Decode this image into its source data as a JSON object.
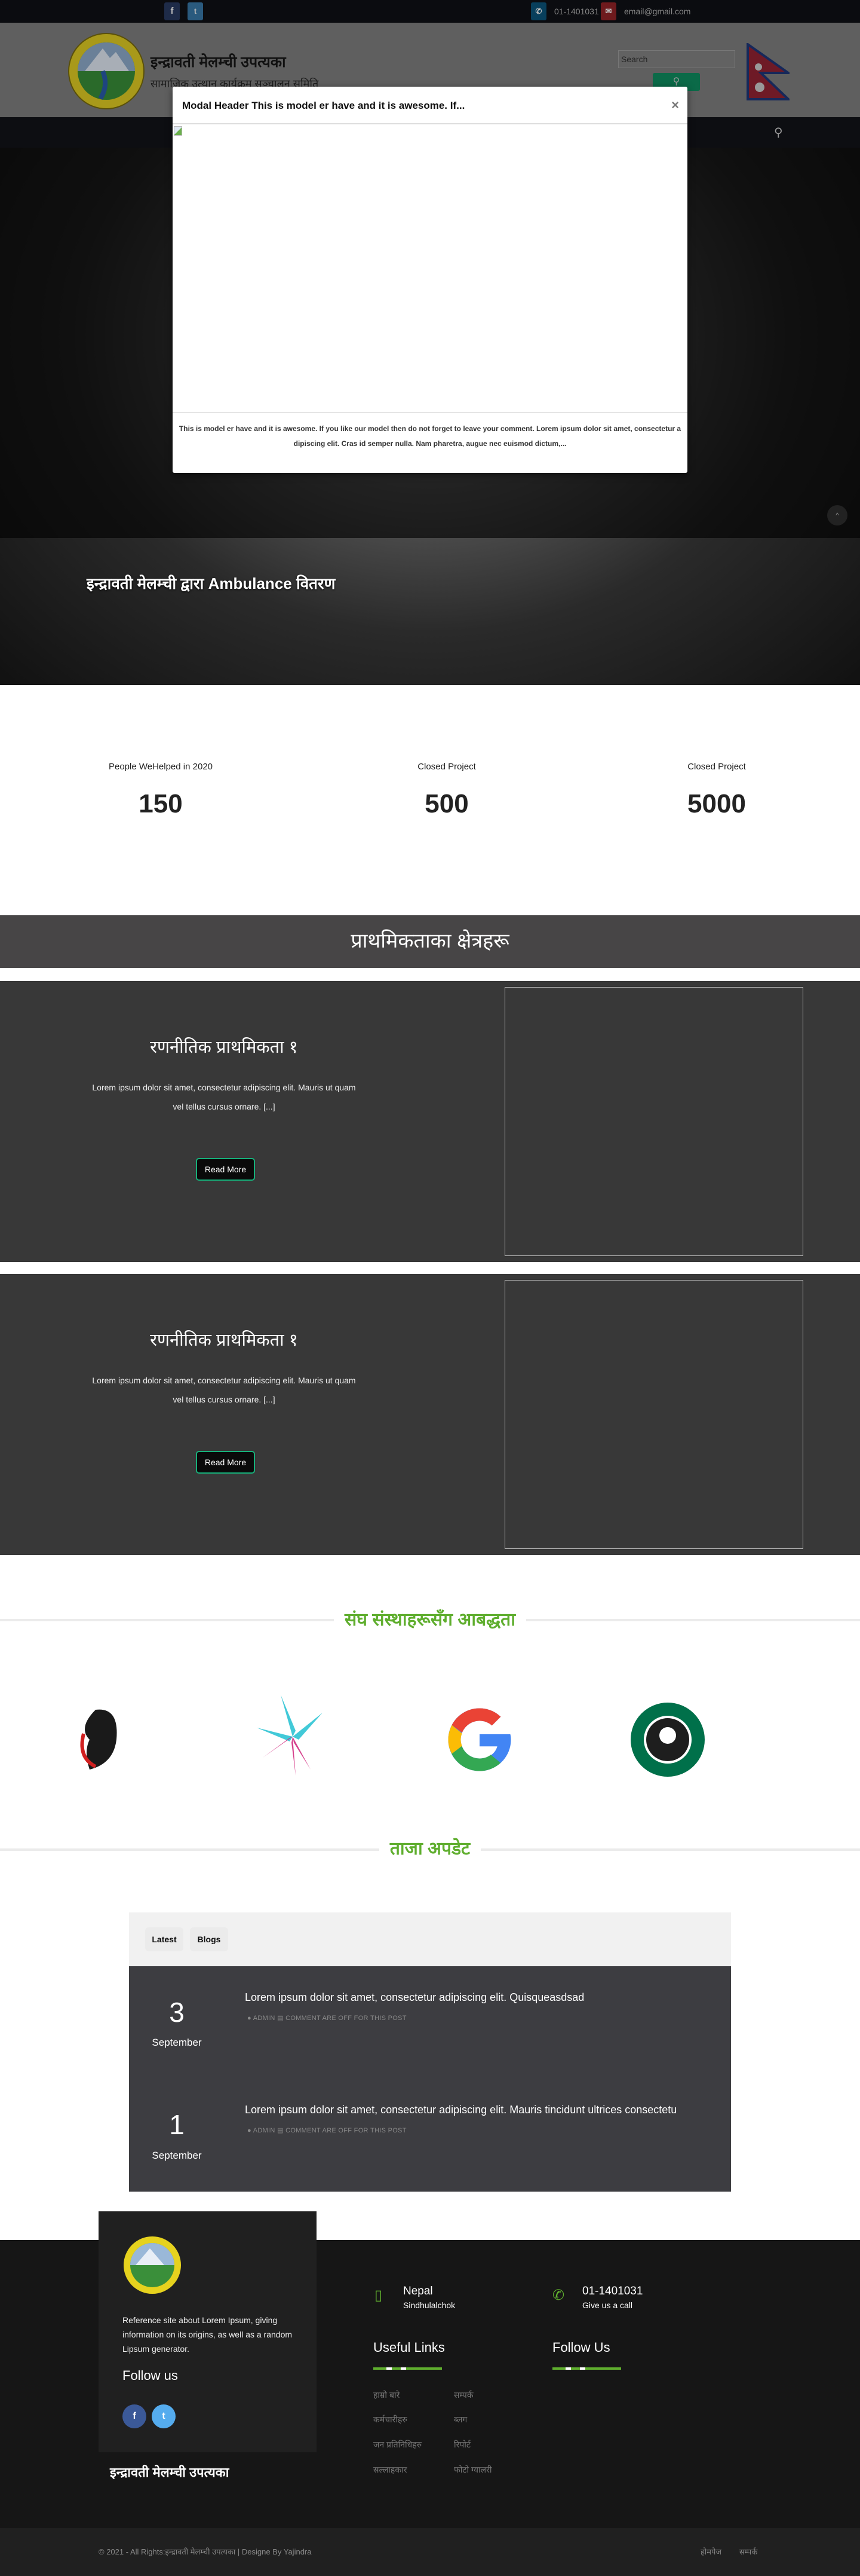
{
  "topbar": {
    "phone": "01-1401031",
    "email": "email@gmail.com",
    "social": [
      "facebook-icon",
      "twitter-icon"
    ]
  },
  "header": {
    "title": "इन्द्रावती मेलम्ची उपत्यका",
    "subtitle": "सामाजिक उत्थान कार्यक्रम सञ्चालन समिति",
    "search_placeholder": "Search"
  },
  "modal": {
    "title": "Modal Header This is model er have and it is awesome. If...",
    "close": "×",
    "body": "This is model er have and it is awesome. If you like our model then do not forget to leave your comment. Lorem ipsum dolor sit amet, consectetur a dipiscing elit. Cras id semper nulla. Nam pharetra, augue nec euismod dictum,..."
  },
  "hero": {
    "caption": "इन्द्रावती मेलम्ची द्वारा Ambulance वितरण",
    "scroll_top": "^"
  },
  "stats": [
    {
      "label": "People WeHelped in 2020",
      "value": "150"
    },
    {
      "label": "Closed Project",
      "value": "500"
    },
    {
      "label": "Closed Project",
      "value": "5000"
    }
  ],
  "priorities": {
    "heading": "प्राथमिकताका क्षेत्रहरू",
    "items": [
      {
        "title": "रणनीतिक प्राथमिकता १",
        "text": "Lorem ipsum dolor sit amet, consectetur adipiscing elit. Mauris ut quam vel tellus cursus ornare. [...]",
        "button": "Read More"
      },
      {
        "title": "रणनीतिक प्राथमिकता १",
        "text": "Lorem ipsum dolor sit amet, consectetur adipiscing elit. Mauris ut quam vel tellus cursus ornare. [...]",
        "button": "Read More"
      }
    ]
  },
  "partners": {
    "heading": "संघ संस्थाहरूसँग आबद्धता"
  },
  "updates": {
    "heading": "ताजा अपडेट",
    "tabs": [
      "Latest",
      "Blogs"
    ],
    "posts": [
      {
        "day": "3",
        "month": "September",
        "title": "Lorem ipsum dolor sit amet, consectetur adipiscing elit. Quisqueasdsad",
        "author": "ADMIN",
        "comments": "COMMENT ARE OFF FOR THIS POST"
      },
      {
        "day": "1",
        "month": "September",
        "title": "Lorem ipsum dolor sit amet, consectetur adipiscing elit. Mauris tincidunt ultrices consectetu",
        "author": "ADMIN",
        "comments": "COMMENT ARE OFF FOR THIS POST"
      }
    ]
  },
  "footer": {
    "about": "Reference site about Lorem Ipsum, giving information on its origins, as well as a random Lipsum generator.",
    "follow_us": "Follow us",
    "org_name": "इन्द्रावती मेलम्ची उपत्यका",
    "location": {
      "title": "Nepal",
      "sub": "Sindhulalchok"
    },
    "phone": {
      "title": "01-1401031",
      "sub": "Give us a call"
    },
    "useful_links_title": "Useful Links",
    "follow_title": "Follow Us",
    "links": [
      "हाम्रो बारे",
      "सम्पर्क",
      "कर्मचारीहरु",
      "ब्लग",
      "जन प्रतिनिधिहरु",
      "रिपोर्ट",
      "सल्लाहकार",
      "फोटो ग्यालरी"
    ],
    "copyright": "© 2021 - All Rights:इन्द्रावती मेलम्ची उपत्यका | Designe By Yajindra",
    "bottom_links": [
      "होमपेज",
      "सम्पर्क"
    ]
  },
  "colors": {
    "accent": "#5fae2e",
    "button_border": "#17b07a",
    "facebook": "#3b5998",
    "twitter": "#55acee"
  }
}
